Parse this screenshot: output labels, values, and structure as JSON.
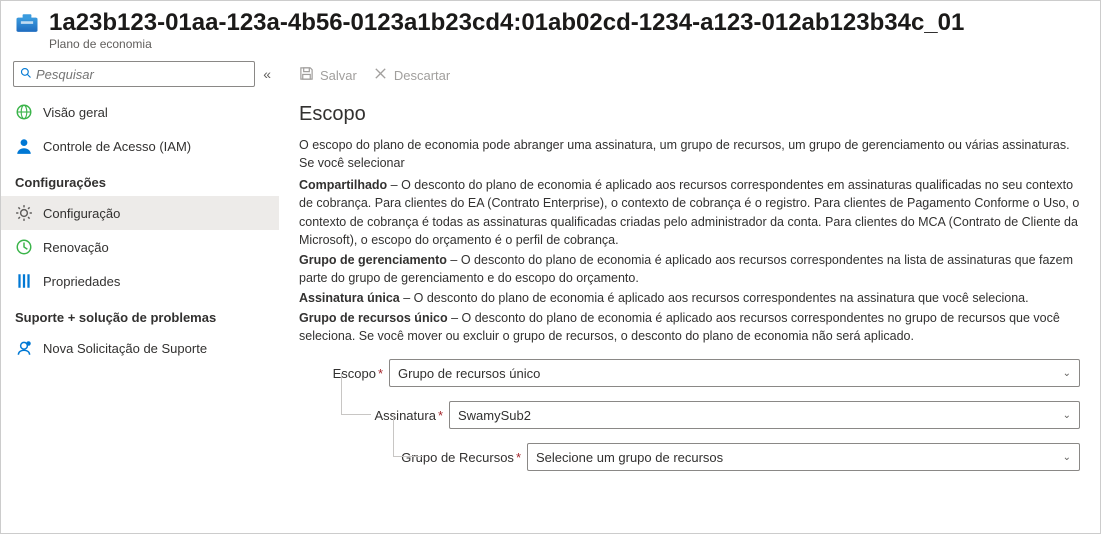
{
  "header": {
    "title": "1a23b123-01aa-123a-4b56-0123a1b23cd4:01ab02cd-1234-a123-012ab123b34c_01",
    "subtitle": "Plano de economia"
  },
  "sidebar": {
    "search_placeholder": "Pesquisar",
    "items_top": [
      {
        "label": "Visão geral"
      },
      {
        "label": "Controle de Acesso (IAM)"
      }
    ],
    "section_settings": "Configurações",
    "items_settings": [
      {
        "label": "Configuração"
      },
      {
        "label": "Renovação"
      },
      {
        "label": "Propriedades"
      }
    ],
    "section_support": "Suporte + solução de problemas",
    "items_support": [
      {
        "label": "Nova Solicitação de Suporte"
      }
    ]
  },
  "toolbar": {
    "save_label": "Salvar",
    "discard_label": "Descartar"
  },
  "content": {
    "section_title": "Escopo",
    "intro": "O escopo do plano de economia pode abranger uma assinatura, um grupo de recursos, um grupo de gerenciamento ou várias assinaturas. Se você selecionar",
    "scopes": {
      "shared_title": "Compartilhado",
      "shared_body": " – O desconto do plano de economia é aplicado aos recursos correspondentes em assinaturas qualificadas no seu contexto de cobrança. Para clientes do EA (Contrato Enterprise), o contexto de cobrança é o registro. Para clientes de Pagamento Conforme o Uso, o contexto de cobrança é todas as assinaturas qualificadas criadas pelo administrador da conta. Para clientes do MCA (Contrato de Cliente da Microsoft), o escopo do orçamento é o perfil de cobrança.",
      "mg_title": "Grupo de gerenciamento",
      "mg_body": " – O desconto do plano de economia é aplicado aos recursos correspondentes na lista de assinaturas que fazem parte do grupo de gerenciamento e do escopo do orçamento.",
      "single_title": "Assinatura única",
      "single_body": " – O desconto do plano de economia é aplicado aos recursos correspondentes na assinatura que você seleciona.",
      "rg_title": "Grupo de recursos único",
      "rg_body": "  – O desconto do plano de economia é aplicado aos recursos correspondentes no grupo de recursos que você seleciona. Se você mover ou excluir o grupo de recursos, o desconto do plano de economia não será aplicado."
    },
    "form": {
      "scope_label": "Escopo",
      "scope_value": "Grupo de recursos único",
      "subscription_label": "Assinatura",
      "subscription_value": "SwamySub2",
      "rg_label": "Grupo de Recursos",
      "rg_value": "Selecione um grupo de recursos"
    }
  }
}
